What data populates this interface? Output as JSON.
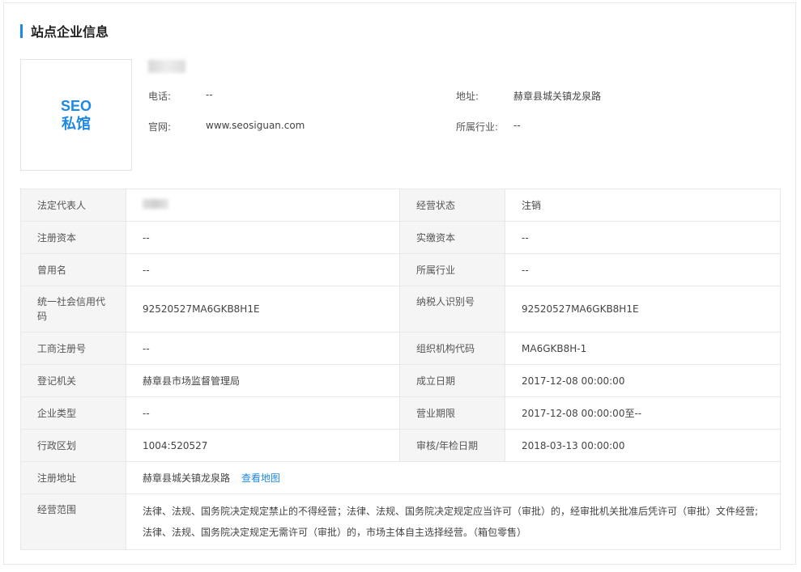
{
  "section": {
    "title": "站点企业信息"
  },
  "logo": {
    "line1": "SEO",
    "line2": "私馆"
  },
  "summary": {
    "phone_label": "电话:",
    "phone_value": "--",
    "website_label": "官网:",
    "website_value": "www.seosiguan.com",
    "address_label": "地址:",
    "address_value": "赫章县城关镇龙泉路",
    "industry_label": "所属行业:",
    "industry_value": "--"
  },
  "table": {
    "legal_rep": {
      "label": "法定代表人"
    },
    "status": {
      "label": "经营状态",
      "value": "注销"
    },
    "reg_capital": {
      "label": "注册资本",
      "value": "--"
    },
    "paid_capital": {
      "label": "实缴资本",
      "value": "--"
    },
    "former_name": {
      "label": "曾用名",
      "value": "--"
    },
    "industry": {
      "label": "所属行业",
      "value": "--"
    },
    "credit_code": {
      "label": "统一社会信用代码",
      "value": "92520527MA6GKB8H1E"
    },
    "taxpayer_id": {
      "label": "纳税人识别号",
      "value": "92520527MA6GKB8H1E"
    },
    "biz_reg_no": {
      "label": "工商注册号",
      "value": "--"
    },
    "org_code": {
      "label": "组织机构代码",
      "value": "MA6GKB8H-1"
    },
    "authority": {
      "label": "登记机关",
      "value": "赫章县市场监督管理局"
    },
    "established": {
      "label": "成立日期",
      "value": "2017-12-08 00:00:00"
    },
    "ent_type": {
      "label": "企业类型",
      "value": "--"
    },
    "biz_term": {
      "label": "营业期限",
      "value": "2017-12-08 00:00:00至--"
    },
    "region": {
      "label": "行政区划",
      "value": "1004:520527"
    },
    "audit_date": {
      "label": "审核/年检日期",
      "value": "2018-03-13 00:00:00"
    },
    "reg_address": {
      "label": "注册地址",
      "value": "赫章县城关镇龙泉路",
      "map_link": "查看地图"
    },
    "scope": {
      "label": "经营范围",
      "value": "法律、法规、国务院决定规定禁止的不得经营；法律、法规、国务院决定规定应当许可（审批）的，经审批机关批准后凭许可（审批）文件经营;法律、法规、国务院决定规定无需许可（审批）的，市场主体自主选择经营。（箱包零售）"
    }
  },
  "colors": {
    "accent": "#1e88e5",
    "label_bg": "#f5f5f5",
    "border": "#e8e8e8"
  }
}
